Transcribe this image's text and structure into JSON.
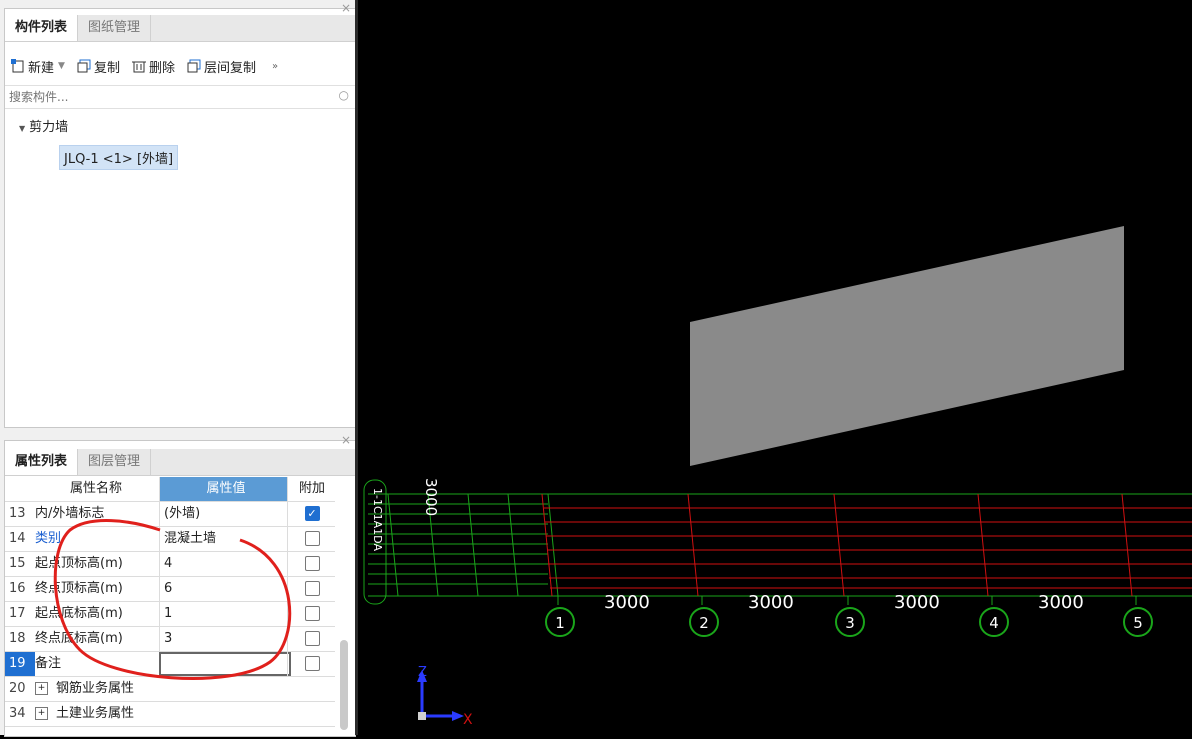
{
  "component_panel": {
    "tabs": [
      {
        "label": "构件列表"
      },
      {
        "label": "图纸管理"
      }
    ],
    "toolbar": {
      "new_label": "新建",
      "copy_label": "复制",
      "delete_label": "删除",
      "floor_copy_label": "层间复制"
    },
    "search_placeholder": "搜索构件...",
    "tree": {
      "category": "剪力墙",
      "item": "JLQ-1 <1> [外墙]"
    }
  },
  "property_panel": {
    "tabs": [
      {
        "label": "属性列表"
      },
      {
        "label": "图层管理"
      }
    ],
    "headers": {
      "name": "属性名称",
      "value": "属性值",
      "extra": "附加"
    },
    "rows": [
      {
        "num": "13",
        "name": "内/外墙标志",
        "value": "(外墙)",
        "checked": true
      },
      {
        "num": "14",
        "name": "类别",
        "value": "混凝土墙",
        "checked": false
      },
      {
        "num": "15",
        "name": "起点顶标高(m)",
        "value": "4",
        "checked": false
      },
      {
        "num": "16",
        "name": "终点顶标高(m)",
        "value": "6",
        "checked": false
      },
      {
        "num": "17",
        "name": "起点底标高(m)",
        "value": "1",
        "checked": false
      },
      {
        "num": "18",
        "name": "终点底标高(m)",
        "value": "3",
        "checked": false
      },
      {
        "num": "19",
        "name": "备注",
        "value": "",
        "checked": false
      },
      {
        "num": "20",
        "name": "钢筋业务属性",
        "value": ""
      },
      {
        "num": "34",
        "name": "土建业务属性",
        "value": ""
      }
    ]
  },
  "viewport": {
    "grid_labels": [
      "1",
      "2",
      "3",
      "4",
      "5"
    ],
    "dimensions": [
      "3000",
      "3000",
      "3000",
      "3000"
    ],
    "left_dimension": "3000",
    "axis_z": "Z",
    "axis_x": "X",
    "colors": {
      "red_grid": "#d01010",
      "green_grid": "#1aa51a",
      "wall": "#8a8a8a"
    }
  }
}
